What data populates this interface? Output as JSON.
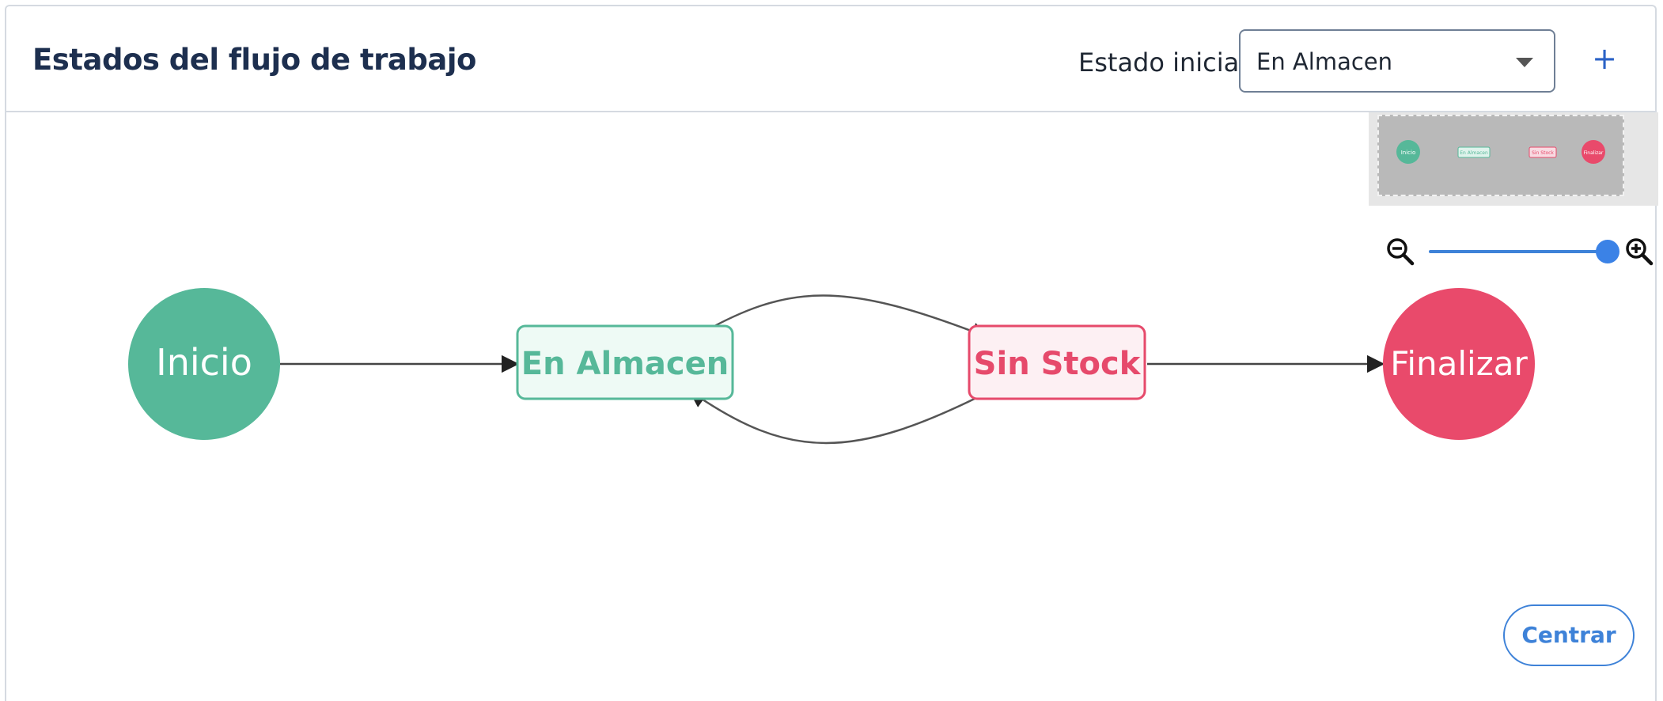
{
  "header": {
    "title": "Estados del flujo de trabajo",
    "initial_state_label": "Estado inicial:",
    "initial_state_value": "En Almacen",
    "add_button": "+"
  },
  "diagram": {
    "nodes": [
      {
        "id": "inicio",
        "label": "Inicio",
        "shape": "circle",
        "color": "#56b899"
      },
      {
        "id": "en-almacen",
        "label": "En Almacen",
        "shape": "rect",
        "color": "#56b899"
      },
      {
        "id": "sin-stock",
        "label": "Sin Stock",
        "shape": "rect",
        "color": "#e64a6b"
      },
      {
        "id": "finalizar",
        "label": "Finalizar",
        "shape": "circle",
        "color": "#e94a6b"
      }
    ],
    "edges": [
      {
        "from": "inicio",
        "to": "en-almacen"
      },
      {
        "from": "en-almacen",
        "to": "sin-stock"
      },
      {
        "from": "sin-stock",
        "to": "en-almacen"
      },
      {
        "from": "sin-stock",
        "to": "finalizar"
      }
    ]
  },
  "minimap": {
    "labels": [
      "Inicio",
      "En Almacen",
      "Sin Stock",
      "Finalizar"
    ]
  },
  "zoom": {
    "level": 1.0
  },
  "actions": {
    "center_label": "Centrar"
  },
  "colors": {
    "accent": "#3e82d8",
    "green": "#56b899",
    "red": "#e94a6b",
    "title": "#1d2f4f"
  }
}
